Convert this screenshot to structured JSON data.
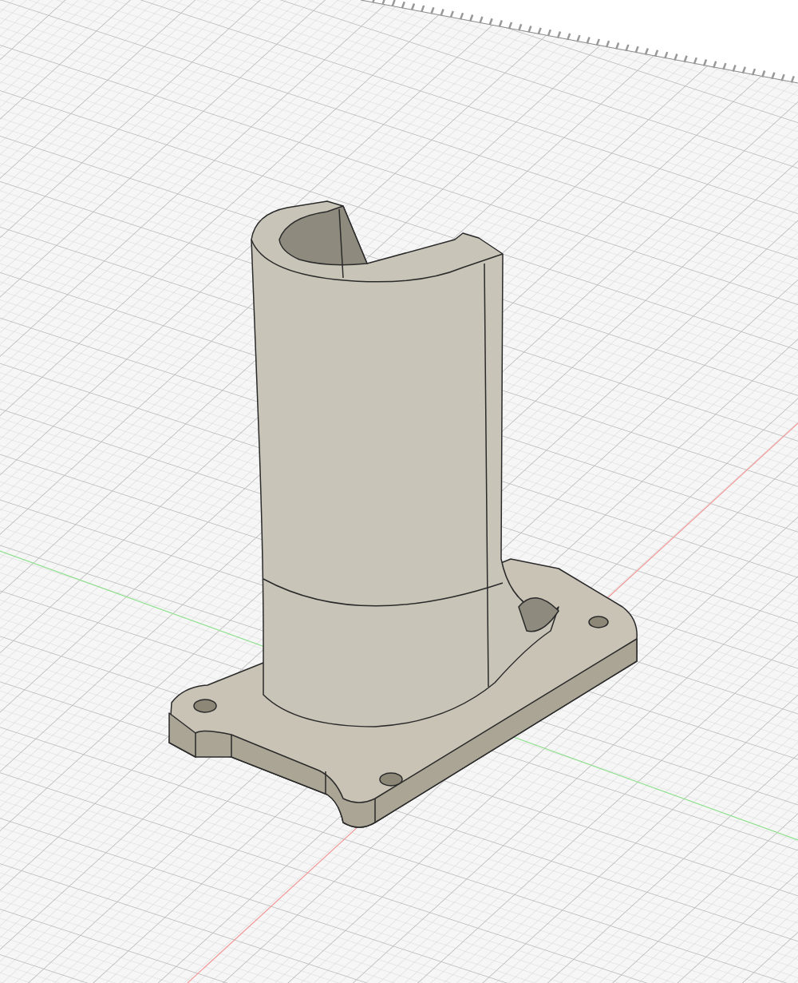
{
  "viewport": {
    "grid_visible": true,
    "axes_visible": true,
    "ruler_visible": true
  }
}
